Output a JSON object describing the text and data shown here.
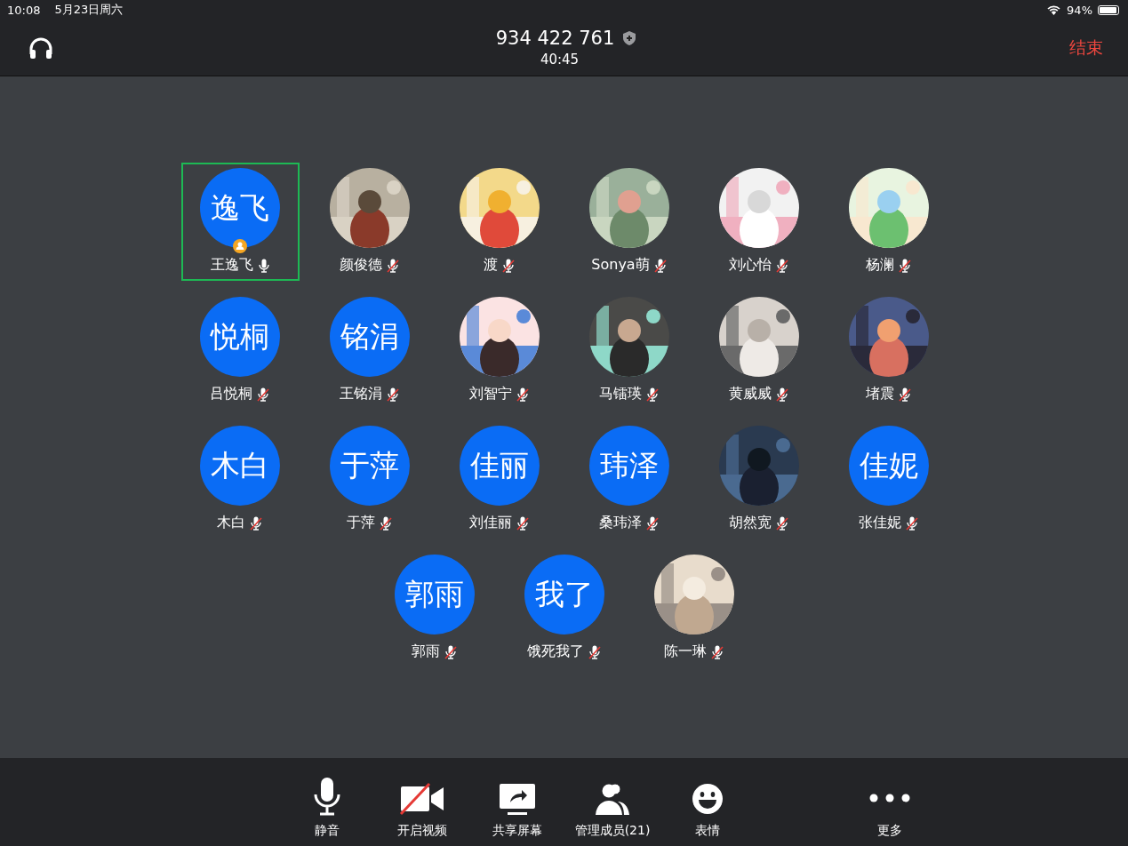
{
  "status_bar": {
    "time": "10:08",
    "date": "5月23日周六",
    "battery": "94%"
  },
  "header": {
    "meeting_id": "934 422 761",
    "duration": "40:45",
    "end_button": "结束"
  },
  "participants": [
    {
      "name": "王逸飞",
      "kind": "initials",
      "initials": "逸飞",
      "muted": false,
      "selected": true,
      "host": true
    },
    {
      "name": "颜俊德",
      "kind": "picture",
      "muted": true,
      "selected": false,
      "host": false
    },
    {
      "name": "渡",
      "kind": "picture",
      "muted": true,
      "selected": false,
      "host": false
    },
    {
      "name": "Sonya萌",
      "kind": "picture",
      "muted": true,
      "selected": false,
      "host": false
    },
    {
      "name": "刘心怡",
      "kind": "picture",
      "muted": true,
      "selected": false,
      "host": false
    },
    {
      "name": "杨澜",
      "kind": "picture",
      "muted": true,
      "selected": false,
      "host": false
    },
    {
      "name": "吕悦桐",
      "kind": "initials",
      "initials": "悦桐",
      "muted": true,
      "selected": false,
      "host": false
    },
    {
      "name": "王铭涓",
      "kind": "initials",
      "initials": "铭涓",
      "muted": true,
      "selected": false,
      "host": false
    },
    {
      "name": "刘智宁",
      "kind": "picture",
      "muted": true,
      "selected": false,
      "host": false
    },
    {
      "name": "马镭瑛",
      "kind": "picture",
      "muted": true,
      "selected": false,
      "host": false
    },
    {
      "name": "黄威威",
      "kind": "picture",
      "muted": true,
      "selected": false,
      "host": false
    },
    {
      "name": "堵震",
      "kind": "picture",
      "muted": true,
      "selected": false,
      "host": false
    },
    {
      "name": "木白",
      "kind": "initials",
      "initials": "木白",
      "muted": true,
      "selected": false,
      "host": false
    },
    {
      "name": "于萍",
      "kind": "initials",
      "initials": "于萍",
      "muted": true,
      "selected": false,
      "host": false
    },
    {
      "name": "刘佳丽",
      "kind": "initials",
      "initials": "佳丽",
      "muted": true,
      "selected": false,
      "host": false
    },
    {
      "name": "桑玮泽",
      "kind": "initials",
      "initials": "玮泽",
      "muted": true,
      "selected": false,
      "host": false
    },
    {
      "name": "胡然宽",
      "kind": "picture",
      "muted": true,
      "selected": false,
      "host": false
    },
    {
      "name": "张佳妮",
      "kind": "initials",
      "initials": "佳妮",
      "muted": true,
      "selected": false,
      "host": false
    },
    {
      "name": "郭雨",
      "kind": "initials",
      "initials": "郭雨",
      "muted": true,
      "selected": false,
      "host": false
    },
    {
      "name": "饿死我了",
      "kind": "initials",
      "initials": "我了",
      "muted": true,
      "selected": false,
      "host": false
    },
    {
      "name": "陈一琳",
      "kind": "picture",
      "muted": true,
      "selected": false,
      "host": false
    }
  ],
  "toolbar": [
    {
      "kind": "mic",
      "label": "静音"
    },
    {
      "kind": "video-off",
      "label": "开启视频"
    },
    {
      "kind": "share",
      "label": "共享屏幕"
    },
    {
      "kind": "members",
      "label": "管理成员(21)"
    },
    {
      "kind": "emoji",
      "label": "表情"
    },
    {
      "kind": "more",
      "label": "更多"
    }
  ]
}
